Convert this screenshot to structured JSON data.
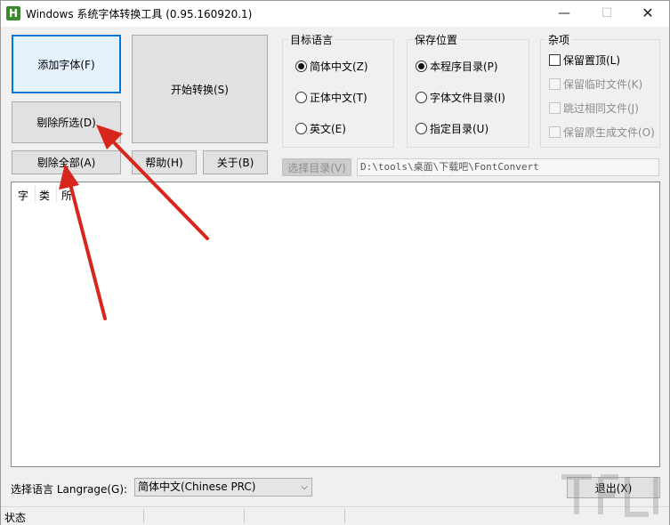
{
  "window": {
    "app_icon_letter": "H",
    "title": "Windows 系统字体转换工具 (0.95.160920.1)",
    "minimize": "—",
    "maximize": "☐",
    "close": "✕"
  },
  "buttons": {
    "add_font": "添加字体(F)",
    "start_convert": "开始转换(S)",
    "remove_selected": "剔除所选(D)",
    "remove_all": "剔除全部(A)",
    "help": "帮助(H)",
    "about": "关于(B)",
    "choose_dir": "选择目录(V)",
    "exit": "退出(X)"
  },
  "target_language": {
    "title": "目标语言",
    "options": [
      "简体中文(Z)",
      "正体中文(T)",
      "英文(E)"
    ],
    "selected": "简体中文(Z)"
  },
  "save_location": {
    "title": "保存位置",
    "options": [
      "本程序目录(P)",
      "字体文件目录(I)",
      "指定目录(U)"
    ],
    "selected": "本程序目录(P)"
  },
  "misc": {
    "title": "杂项",
    "options": [
      "保留置顶(L)",
      "保留临时文件(K)",
      "跳过相同文件(J)",
      "保留原生成文件(O)"
    ],
    "checked": []
  },
  "path_value": "D:\\tools\\桌面\\下载吧\\FontConvert",
  "list_columns": [
    "字",
    "类",
    "所"
  ],
  "language_label": "选择语言 Langrage(G):",
  "language_value": "简体中文(Chinese PRC)",
  "status": "状态",
  "colors": {
    "arrow": "#d9261c",
    "focus_border": "#0078d7",
    "app_icon": "#3c8a2e"
  }
}
